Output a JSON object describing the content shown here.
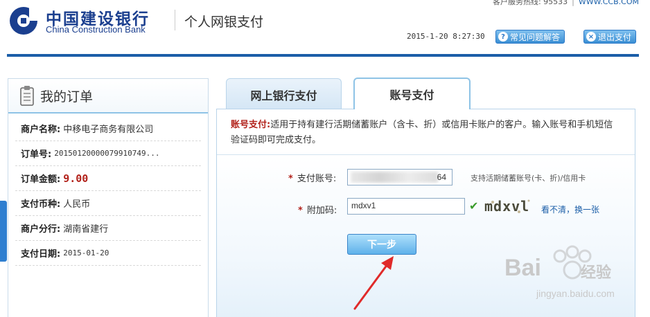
{
  "header": {
    "hotline": "客户服务热线: 95533",
    "site": "WWW.CCB.COM",
    "brand_cn": "中国建设银行",
    "brand_en": "China Construction Bank",
    "service_name": "个人网银支付",
    "datetime": "2015-1-20 8:27:30",
    "faq_label": "常见问题解答",
    "exit_label": "退出支付",
    "logo_icon": "ccb-logo-icon",
    "brand_color": "#1b3f8f"
  },
  "order": {
    "title": "我的订单",
    "rows": [
      {
        "label": "商户名称:",
        "value": "中移电子商务有限公司"
      },
      {
        "label": "订单号:",
        "value": "20150120000079910749..."
      },
      {
        "label": "订单金额:",
        "value": "9.00"
      },
      {
        "label": "支付币种:",
        "value": "人民币"
      },
      {
        "label": "商户分行:",
        "value": "湖南省建行"
      },
      {
        "label": "支付日期:",
        "value": "2015-01-20"
      }
    ]
  },
  "tabs": {
    "online": "网上银行支付",
    "account": "账号支付"
  },
  "description": {
    "keyword": "账号支付:",
    "text": "适用于持有建行活期储蓄账户（含卡、折）或信用卡账户的客户。输入账号和手机短信验证码即可完成支付。"
  },
  "form": {
    "account_label": "支付账号:",
    "account_tail": "64",
    "account_hint": "支持活期储蓄账号(卡、折)/信用卡",
    "code_label": "附加码:",
    "code_value": "mdxv1",
    "captcha_text": "mdxvl",
    "refresh_text": "看不清，",
    "refresh_link": "换一张",
    "next_label": "下一步"
  },
  "watermark": {
    "brand": "Bai",
    "cn": "经验",
    "url": "jingyan.baidu.com"
  }
}
